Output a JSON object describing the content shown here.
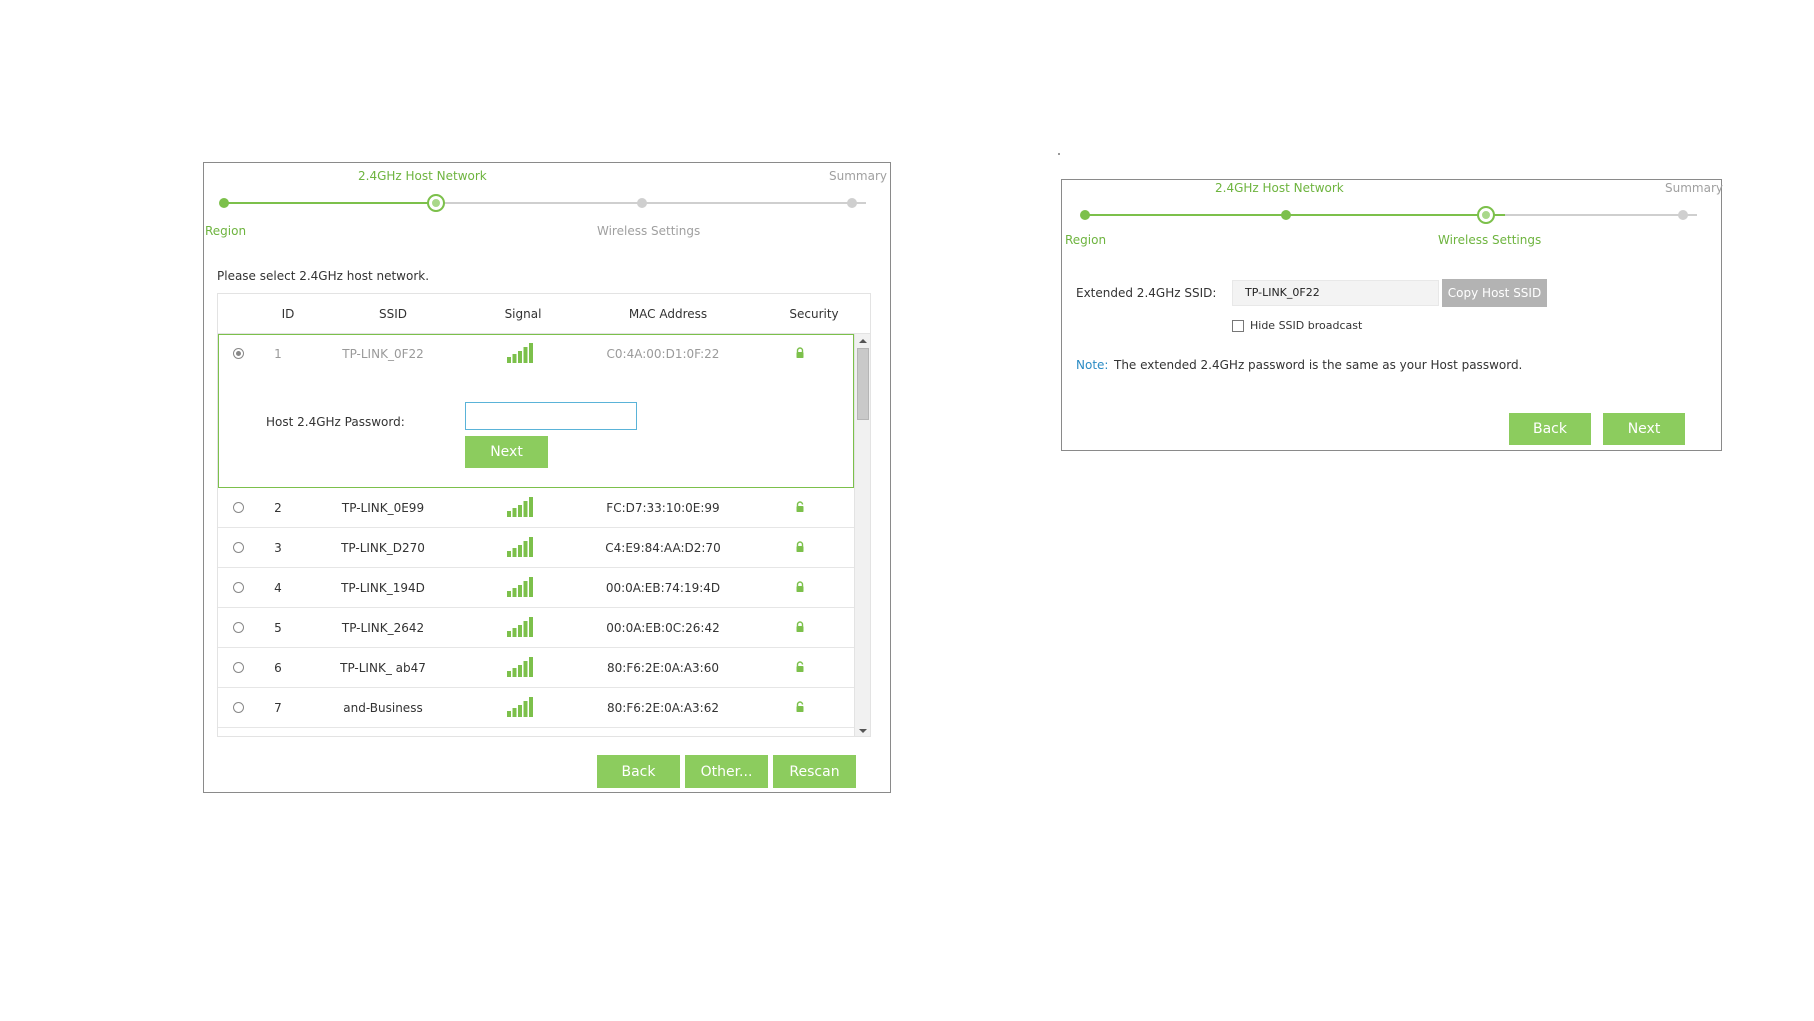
{
  "left": {
    "steps": {
      "top_label": "2.4GHz Host Network",
      "summary": "Summary",
      "region": "Region",
      "wireless_settings": "Wireless Settings"
    },
    "prompt": "Please select 2.4GHz host network.",
    "columns": [
      "ID",
      "SSID",
      "Signal",
      "MAC Address",
      "Security"
    ],
    "networks": [
      {
        "id": "1",
        "ssid": "TP-LINK_0F22",
        "mac": "C0:4A:00:D1:0F:22",
        "signal": 5,
        "lock": "locked",
        "selected": true
      },
      {
        "id": "2",
        "ssid": "TP-LINK_0E99",
        "mac": "FC:D7:33:10:0E:99",
        "signal": 5,
        "lock": "unlocked",
        "selected": false
      },
      {
        "id": "3",
        "ssid": "TP-LINK_D270",
        "mac": "C4:E9:84:AA:D2:70",
        "signal": 5,
        "lock": "locked",
        "selected": false
      },
      {
        "id": "4",
        "ssid": "TP-LINK_194D",
        "mac": "00:0A:EB:74:19:4D",
        "signal": 5,
        "lock": "locked",
        "selected": false
      },
      {
        "id": "5",
        "ssid": "TP-LINK_2642",
        "mac": "00:0A:EB:0C:26:42",
        "signal": 5,
        "lock": "locked",
        "selected": false
      },
      {
        "id": "6",
        "ssid": "TP-LINK_ ab47",
        "mac": "80:F6:2E:0A:A3:60",
        "signal": 5,
        "lock": "unlocked",
        "selected": false
      },
      {
        "id": "7",
        "ssid": "and-Business",
        "mac": "80:F6:2E:0A:A3:62",
        "signal": 5,
        "lock": "unlocked",
        "selected": false
      }
    ],
    "password_label": "Host 2.4GHz Password:",
    "password_value": "",
    "next_button": "Next",
    "back_button": "Back",
    "other_button": "Other...",
    "rescan_button": "Rescan"
  },
  "right": {
    "steps": {
      "top_label": "2.4GHz Host Network",
      "summary": "Summary",
      "region": "Region",
      "wireless_settings": "Wireless Settings"
    },
    "ssid_label": "Extended 2.4GHz SSID:",
    "ssid_value": "TP-LINK_0F22",
    "copy_button": "Copy Host SSID",
    "hide_ssid_label": "Hide SSID broadcast",
    "hide_ssid_checked": false,
    "note_key": "Note:",
    "note_text": "The extended 2.4GHz password is the same as your Host password.",
    "back_button": "Back",
    "next_button": "Next"
  },
  "colors": {
    "accent_green": "#8ccc5e",
    "step_green": "#7cc04b",
    "note_blue": "#2a8bc4",
    "input_border_blue": "#5ab3d8"
  },
  "icons": {
    "signal": "signal-bars-icon",
    "locked": "lock-closed-icon",
    "unlocked": "lock-open-icon"
  }
}
